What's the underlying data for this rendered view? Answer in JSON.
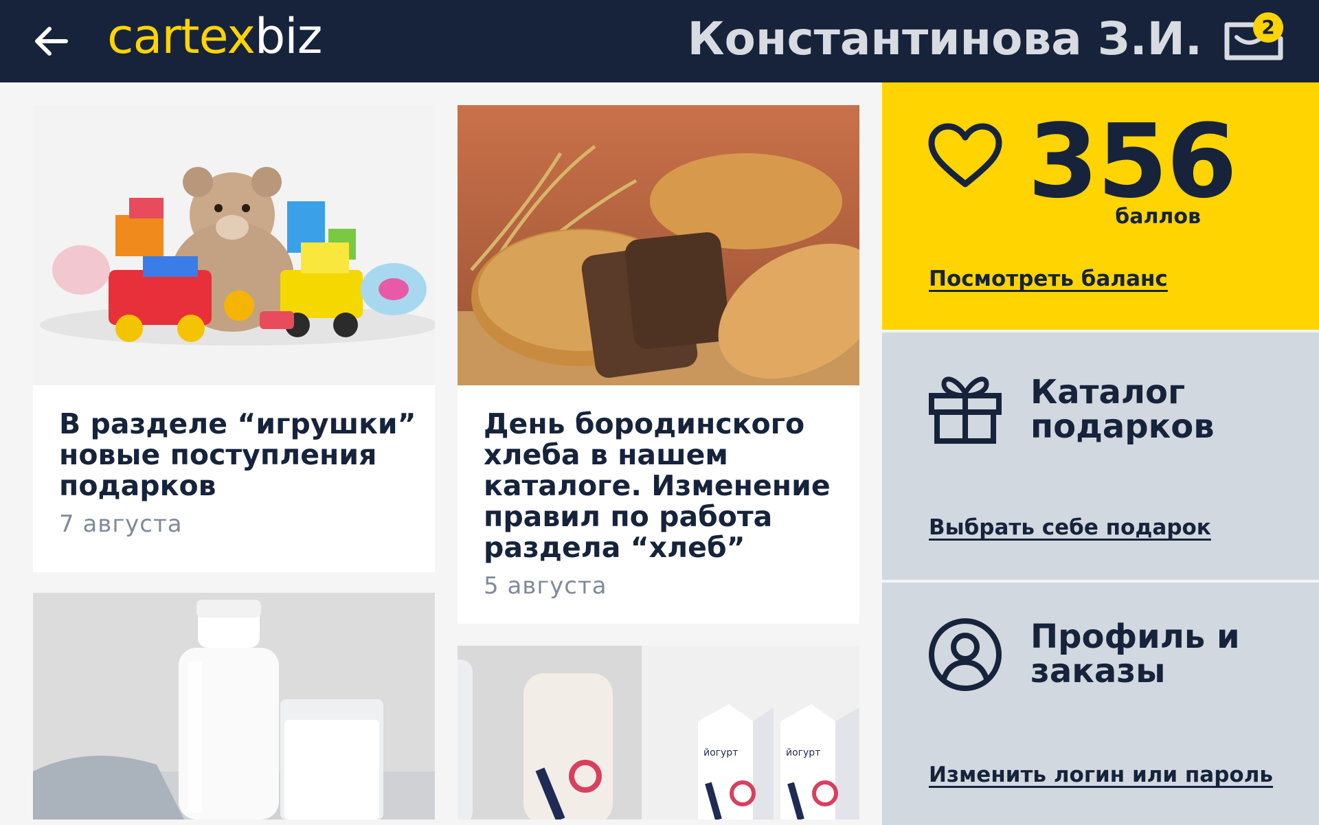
{
  "header": {
    "logo_part1": "cartex",
    "logo_part2": "biz",
    "user_name": "Константинова З.И.",
    "cart_count": "2"
  },
  "feed": {
    "cards": [
      {
        "title_lines": [
          "В разделе “игрушки”",
          "новые поступления",
          "подарков"
        ],
        "date": "7 августа",
        "image": "toys-photo"
      },
      {
        "title_lines": [
          "День бородинского",
          "хлеба в нашем",
          "каталоге. Изменение",
          "правил по работа",
          "раздела “хлеб”"
        ],
        "date": "5 августа",
        "image": "bread-photo"
      },
      {
        "image": "milk-photo"
      },
      {
        "image": "yogurt-photo",
        "pack_label": "йогурт"
      }
    ]
  },
  "sidebar": {
    "points": {
      "value": "356",
      "unit": "баллов",
      "link": "Посмотреть баланс"
    },
    "catalog": {
      "title_line1": "Каталог",
      "title_line2": "подарков",
      "link": "Выбрать себе подарок"
    },
    "profile": {
      "title_line1": "Профиль и",
      "title_line2": "заказы",
      "link": "Изменить логин или пароль"
    }
  },
  "colors": {
    "navy": "#16233b",
    "accent": "#ffd400",
    "panel_grey": "#d2d8e0",
    "date_grey": "#7e8a99"
  }
}
